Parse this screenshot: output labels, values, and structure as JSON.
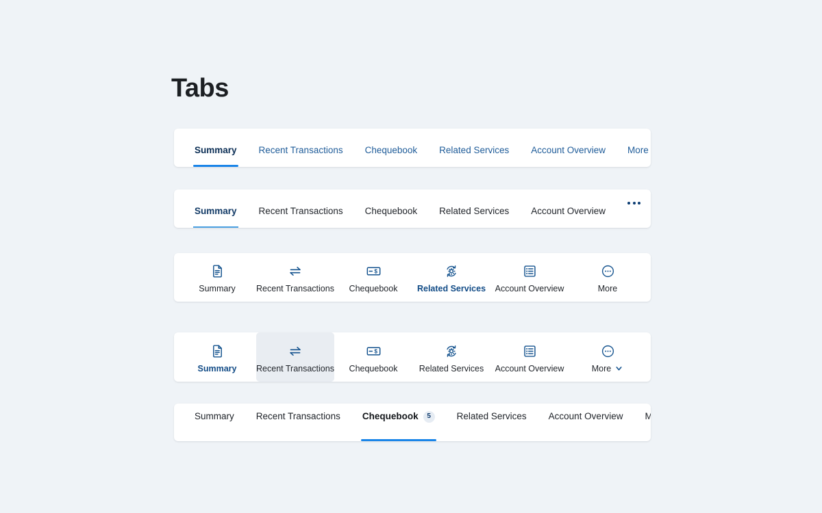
{
  "page": {
    "title": "Tabs",
    "background_color": "#eff3f7",
    "card_color": "#ffffff",
    "accent_color": "#1a85e8",
    "link_color": "#1f5c99",
    "active_dark_color": "#0b2e55",
    "text_color": "#20242a",
    "hover_background": "#e9edf2",
    "badge_background": "#e6ecf3"
  },
  "bars": {
    "bar1": {
      "name": "underline-tabs-blue-links",
      "tabs": [
        {
          "label": "Summary",
          "active": true
        },
        {
          "label": "Recent Transactions",
          "active": false
        },
        {
          "label": "Chequebook",
          "active": false
        },
        {
          "label": "Related Services",
          "active": false
        },
        {
          "label": "Account Overview",
          "active": false
        },
        {
          "label": "More",
          "active": false,
          "icon": "chevron-down-icon"
        }
      ]
    },
    "bar2": {
      "name": "underline-tabs-dark-links-with-overflow",
      "tabs": [
        {
          "label": "Summary",
          "active": true
        },
        {
          "label": "Recent Transactions",
          "active": false
        },
        {
          "label": "Chequebook",
          "active": false
        },
        {
          "label": "Related Services",
          "active": false
        },
        {
          "label": "Account Overview",
          "active": false
        }
      ],
      "overflow": {
        "icon": "ellipsis-horizontal-icon"
      }
    },
    "bar3": {
      "name": "icon-tabs",
      "tabs": [
        {
          "label": "Summary",
          "icon": "document-icon",
          "active": false
        },
        {
          "label": "Recent Transactions",
          "icon": "transfer-arrows-icon",
          "active": false
        },
        {
          "label": "Chequebook",
          "icon": "cheque-dollar-icon",
          "active": false
        },
        {
          "label": "Related Services",
          "icon": "gear-refresh-icon",
          "active": true
        },
        {
          "label": "Account Overview",
          "icon": "list-view-icon",
          "active": false
        },
        {
          "label": "More",
          "icon": "ellipsis-circle-icon",
          "active": false
        }
      ]
    },
    "bar4": {
      "name": "icon-tabs-with-hover-state",
      "tabs": [
        {
          "label": "Summary",
          "icon": "document-icon",
          "active": true,
          "hovered": false
        },
        {
          "label": "Recent Transactions",
          "icon": "transfer-arrows-icon",
          "active": false,
          "hovered": true
        },
        {
          "label": "Chequebook",
          "icon": "cheque-dollar-icon",
          "active": false,
          "hovered": false
        },
        {
          "label": "Related Services",
          "icon": "gear-refresh-icon",
          "active": false,
          "hovered": false
        },
        {
          "label": "Account Overview",
          "icon": "list-view-icon",
          "active": false,
          "hovered": false
        },
        {
          "label": "More",
          "icon": "ellipsis-circle-icon",
          "active": false,
          "hovered": false,
          "trailing_icon": "chevron-down-icon"
        }
      ]
    },
    "bar5": {
      "name": "underline-tabs-with-badge",
      "tabs": [
        {
          "label": "Summary",
          "active": false
        },
        {
          "label": "Recent Transactions",
          "active": false
        },
        {
          "label": "Chequebook",
          "active": true,
          "badge": "5"
        },
        {
          "label": "Related Services",
          "active": false
        },
        {
          "label": "Account Overview",
          "active": false
        },
        {
          "label": "More",
          "active": false,
          "icon": "chevron-down-icon"
        }
      ]
    }
  }
}
